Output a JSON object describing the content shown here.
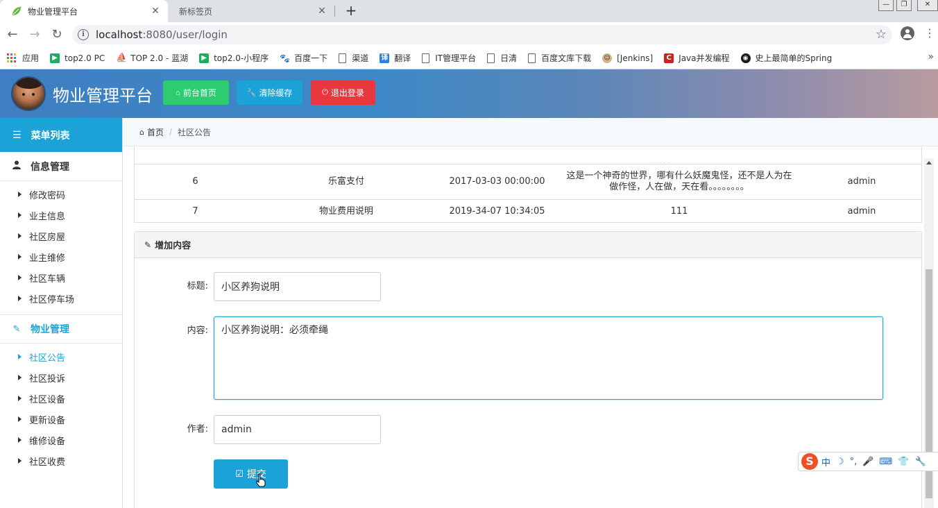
{
  "browser": {
    "tabs": [
      {
        "title": "物业管理平台",
        "active": true
      },
      {
        "title": "新标签页",
        "active": false
      }
    ],
    "url_host": "localhost",
    "url_rest": ":8080/user/login",
    "bookmarks": [
      {
        "label": "应用",
        "icon": "apps-grid-icon"
      },
      {
        "label": "top2.0 PC",
        "icon": "play-green-icon"
      },
      {
        "label": "TOP 2.0 - 蓝湖",
        "icon": "lanhu-icon"
      },
      {
        "label": "top2.0-小程序",
        "icon": "play-green-icon"
      },
      {
        "label": "百度一下",
        "icon": "baidu-paw-icon"
      },
      {
        "label": "渠道",
        "icon": "page-icon"
      },
      {
        "label": "翻译",
        "icon": "translate-icon"
      },
      {
        "label": "IT管理平台",
        "icon": "page-icon"
      },
      {
        "label": "日清",
        "icon": "page-icon"
      },
      {
        "label": "百度文库下载",
        "icon": "page-icon"
      },
      {
        "label": "[Jenkins]",
        "icon": "jenkins-icon"
      },
      {
        "label": "Java并发编程",
        "icon": "csdn-icon"
      },
      {
        "label": "史上最简单的Spring",
        "icon": "github-icon"
      }
    ],
    "bookmarks_more": "»"
  },
  "header": {
    "title": "物业管理平台",
    "buttons": [
      {
        "label": "前台首页",
        "icon": "home-icon",
        "color": "#2ecc71"
      },
      {
        "label": "清除缓存",
        "icon": "wrench-icon",
        "color": "#1ba3d8"
      },
      {
        "label": "退出登录",
        "icon": "power-icon",
        "color": "#e8383d"
      }
    ]
  },
  "sidebar": {
    "menu_title": "菜单列表",
    "groups": [
      {
        "label": "信息管理",
        "icon": "user-icon",
        "items": [
          "修改密码",
          "业主信息",
          "社区房屋",
          "业主维修",
          "社区车辆",
          "社区停车场"
        ]
      },
      {
        "label": "物业管理",
        "icon": "edit-icon",
        "items": [
          "社区公告",
          "社区投诉",
          "社区设备",
          "更新设备",
          "维修设备",
          "社区收费"
        ]
      }
    ],
    "active_item": "社区公告"
  },
  "breadcrumb": {
    "home": "首页",
    "current": "社区公告"
  },
  "table": {
    "rows": [
      {
        "id": "6",
        "title": "乐富支付",
        "time": "2017-03-03 00:00:00",
        "content_line1": "这是一个神奇的世界，哪有什么妖魔鬼怪，还不是人为在",
        "content_line2": "做作怪，人在做，天在看。。。。。。。。",
        "author": "admin"
      },
      {
        "id": "7",
        "title": "物业费用说明",
        "time": "2019-34-07 10:34:05",
        "content_line1": "111",
        "content_line2": "",
        "author": "admin"
      }
    ]
  },
  "form": {
    "panel_title": "增加内容",
    "title_label": "标题:",
    "title_value": "小区养狗说明",
    "content_label": "内容:",
    "content_value": "小区养狗说明：必须牵绳",
    "author_label": "作者:",
    "author_value": "admin",
    "submit_label": "提交"
  },
  "ime": {
    "items": [
      "中",
      "☽",
      "°,",
      "🎤",
      "⌨",
      "👕",
      "🔧"
    ]
  },
  "colors": {
    "accent": "#1ba3d8",
    "green": "#2ecc71",
    "red": "#e8383d"
  }
}
